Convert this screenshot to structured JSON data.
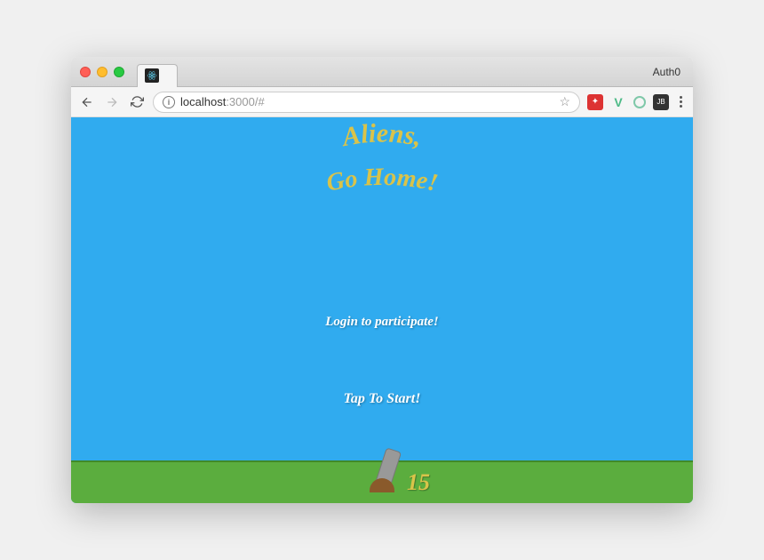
{
  "browser": {
    "profile_label": "Auth0",
    "url": {
      "host": "localhost",
      "port": ":3000",
      "path": "/#"
    }
  },
  "game": {
    "title_line1": "Aliens,",
    "title_line2": "Go Home!",
    "login_msg": "Login to participate!",
    "start_msg": "Tap To Start!",
    "score": "15"
  },
  "colors": {
    "sky": "#30abef",
    "ground": "#5bad3e",
    "title": "#d9c34a"
  }
}
